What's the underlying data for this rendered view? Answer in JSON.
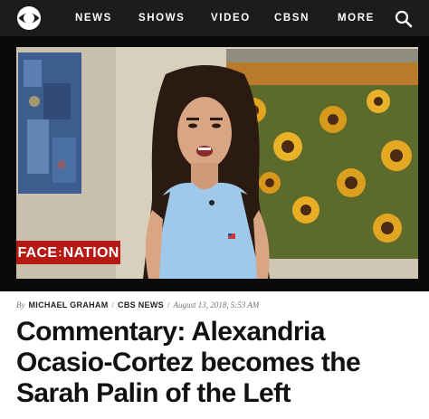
{
  "nav": {
    "items": [
      "NEWS",
      "SHOWS",
      "VIDEO",
      "CBSN",
      "MORE"
    ]
  },
  "icons": {
    "logo": "cbs-eye-logo",
    "search": "search-icon"
  },
  "video": {
    "watermark_left": "FACE",
    "watermark_right": "NATION",
    "accent_color": "#b71915"
  },
  "byline": {
    "by": "By",
    "author": "MICHAEL GRAHAM",
    "source": "CBS NEWS",
    "date": "August 13, 2018, 5:53 AM"
  },
  "headline": "Commentary: Alexandria Ocasio-Cortez becomes the Sarah Palin of the Left"
}
